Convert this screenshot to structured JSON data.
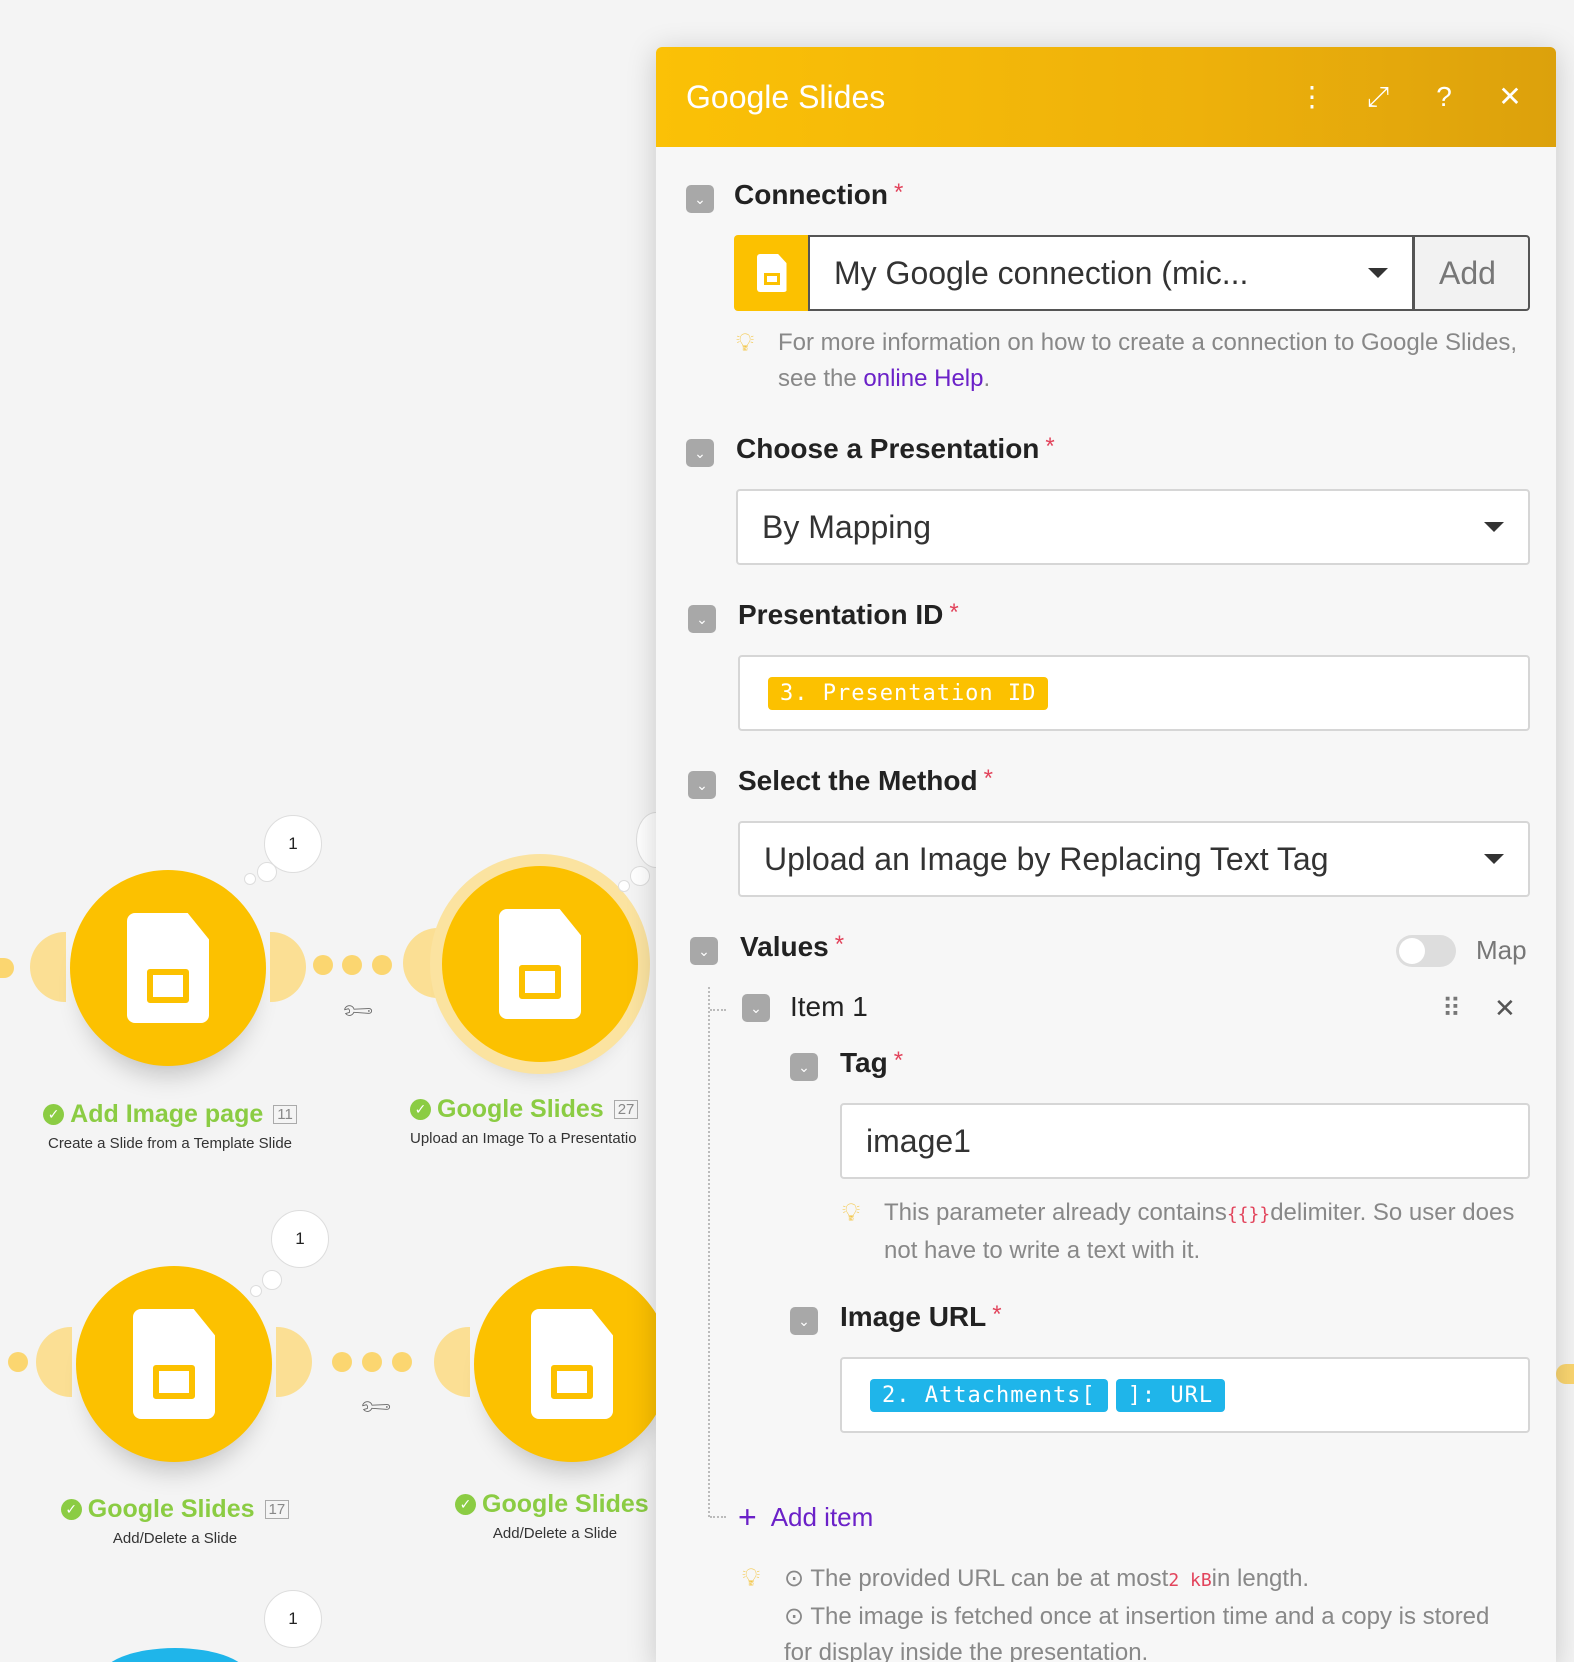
{
  "canvas": {
    "modules": [
      {
        "title": "Add Image page",
        "number": "11",
        "subtitle": "Create a Slide from a Template Slide",
        "bubble": "1"
      },
      {
        "title": "Google Slides",
        "number": "27",
        "subtitle": "Upload an Image To a Presentatio"
      },
      {
        "title": "Google Slides",
        "number": "17",
        "subtitle": "Add/Delete a Slide",
        "bubble": "1"
      },
      {
        "title": "Google Slides",
        "subtitle": "Add/Delete a Slide"
      }
    ],
    "bottom_bubble": "1",
    "colors": {
      "module": "#fcc100",
      "success": "#8bcc43",
      "accent": "#1fb5ea"
    }
  },
  "panel": {
    "title": "Google Slides",
    "header_icons": [
      "more-icon",
      "expand-icon",
      "help-icon",
      "close-icon"
    ],
    "connection": {
      "label": "Connection",
      "value": "My Google connection (mic...",
      "add_label": "Add",
      "hint_text": "For more information on how to create a connection to Google Slides, see the ",
      "hint_link": "online Help",
      "hint_end": "."
    },
    "presentation": {
      "label": "Choose a Presentation",
      "value": "By Mapping"
    },
    "presentation_id": {
      "label": "Presentation ID",
      "token": "3. Presentation ID"
    },
    "method": {
      "label": "Select the Method",
      "value": "Upload an Image by Replacing Text Tag"
    },
    "values": {
      "label": "Values",
      "map_label": "Map",
      "item_label": "Item 1",
      "tag": {
        "label": "Tag",
        "value": "image1",
        "hint_before": "This parameter already contains",
        "hint_code": "{{}}",
        "hint_after": "delimiter. So user does not have to write a text with it."
      },
      "image_url": {
        "label": "Image URL",
        "token1": "2. Attachments[",
        "token2": "]: URL"
      },
      "add_item": "Add item"
    },
    "footer_hint": {
      "line1_before": "The provided URL can be at most",
      "line1_code": "2 kB",
      "line1_after": "in length.",
      "line2": "The image is fetched once at insertion time and a copy is stored for display inside the presentation."
    },
    "colors": {
      "header": "#fbc106",
      "required": "#e2445c",
      "link": "#6b21c8"
    }
  }
}
